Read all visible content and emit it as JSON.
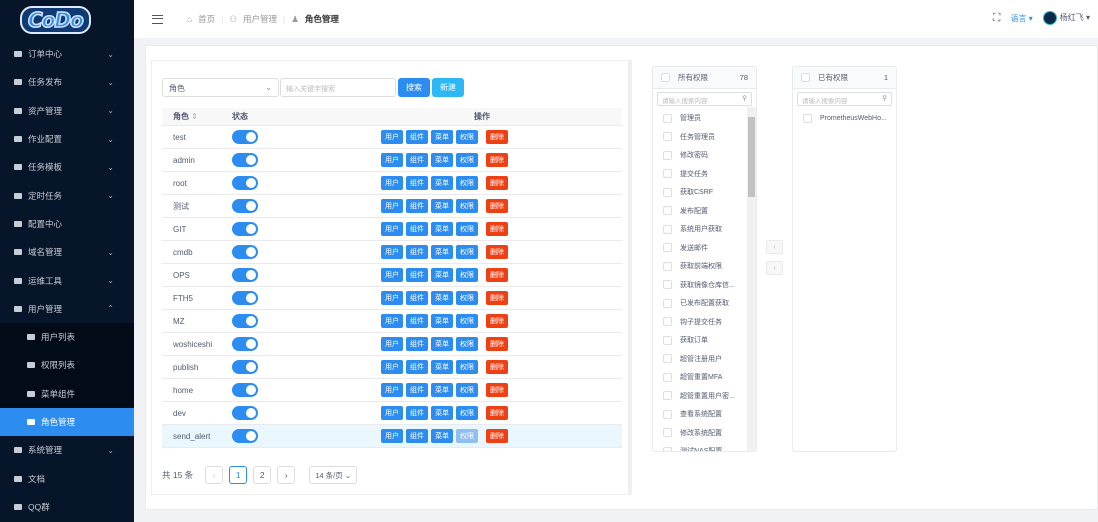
{
  "logo": "CoDo",
  "sidebar": {
    "items": [
      {
        "label": "订单中心"
      },
      {
        "label": "任务发布"
      },
      {
        "label": "资产管理"
      },
      {
        "label": "作业配置"
      },
      {
        "label": "任务模板"
      },
      {
        "label": "定时任务"
      },
      {
        "label": "配置中心"
      },
      {
        "label": "域名管理"
      },
      {
        "label": "运维工具"
      },
      {
        "label": "用户管理"
      }
    ],
    "sub": [
      {
        "label": "用户列表"
      },
      {
        "label": "权限列表"
      },
      {
        "label": "菜单组件"
      },
      {
        "label": "角色管理"
      }
    ],
    "bottom": [
      {
        "label": "系统管理"
      },
      {
        "label": "文档"
      },
      {
        "label": "QQ群"
      }
    ]
  },
  "header": {
    "breadcrumb": [
      "首页",
      "用户管理",
      "角色管理"
    ],
    "language": "语言",
    "user": "杨红飞"
  },
  "filter": {
    "select": "角色",
    "placeholder": "输入关键字搜索",
    "search": "搜索",
    "create": "新建"
  },
  "table": {
    "headers": [
      "角色",
      "状态",
      "操作"
    ],
    "actions": [
      "用户",
      "组件",
      "菜单",
      "权限",
      "删除"
    ],
    "rows": [
      "test",
      "admin",
      "root",
      "测试",
      "GIT",
      "cmdb",
      "OPS",
      "FTH5",
      "MZ",
      "woshiceshi",
      "publish",
      "home",
      "dev",
      "send_alert"
    ]
  },
  "pager": {
    "total": "共 15 条",
    "pages": [
      "1",
      "2"
    ],
    "size": "14 条/页"
  },
  "transfer": {
    "left_title": "所有权限",
    "left_count": "78",
    "right_title": "已有权限",
    "right_count": "1",
    "placeholder": "请输入搜索内容",
    "left_items": [
      "管理员",
      "任务管理员",
      "修改密码",
      "提交任务",
      "获取CSRF",
      "发布配置",
      "系统用户获取",
      "发送邮件",
      "获取前端权限",
      "获取镜像仓库信...",
      "已发布配置获取",
      "钩子提交任务",
      "获取订单",
      "超管注册用户",
      "超管重置MFA",
      "超管重置用户密...",
      "查看系统配置",
      "修改系统配置",
      "测试NAS配置"
    ],
    "right_items": [
      "PrometheusWebHo..."
    ]
  }
}
